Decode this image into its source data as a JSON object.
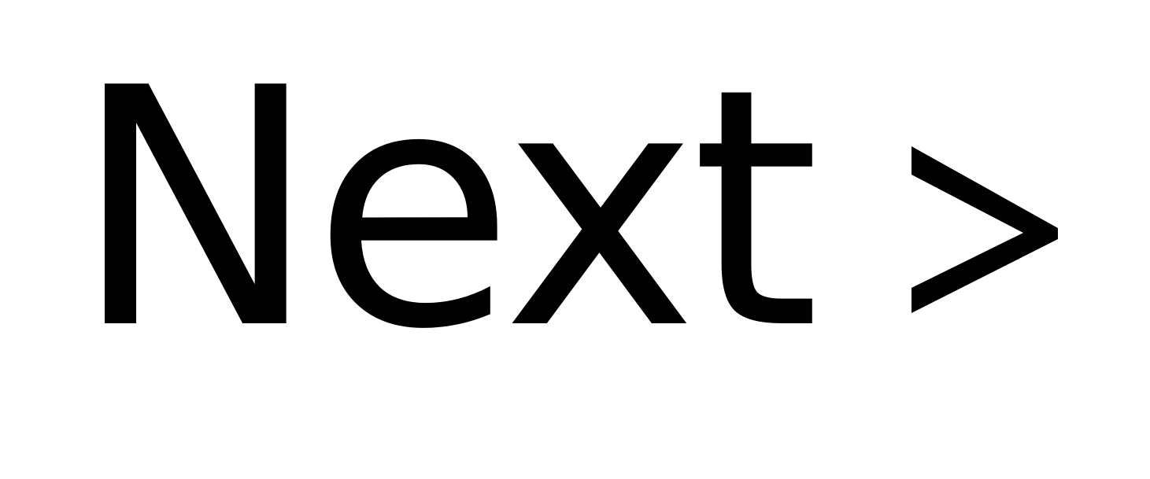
{
  "button": {
    "label": "Next",
    "icon": "chevron-right-icon",
    "text_color": "#000000",
    "background_color": "#ffffff"
  }
}
